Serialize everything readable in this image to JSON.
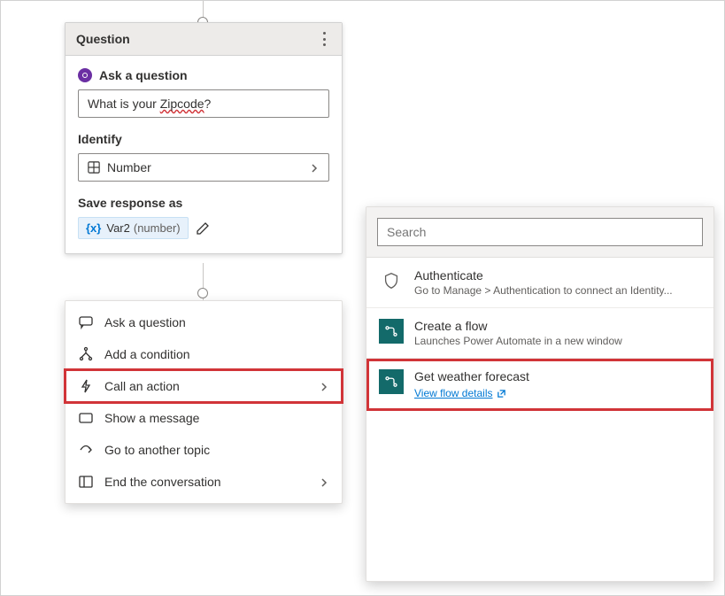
{
  "question_card": {
    "header_title": "Question",
    "ask_label": "Ask a question",
    "question_text_prefix": "What is your ",
    "question_text_word": "Zipcode",
    "question_text_suffix": "?",
    "identify_label": "Identify",
    "identify_value": "Number",
    "save_label": "Save response as",
    "variable_name": "Var2",
    "variable_type": "(number)"
  },
  "action_menu": {
    "items": [
      {
        "icon": "chat",
        "label": "Ask a question"
      },
      {
        "icon": "branch",
        "label": "Add a condition"
      },
      {
        "icon": "bolt",
        "label": "Call an action",
        "has_chevron": true,
        "highlighted": true
      },
      {
        "icon": "message",
        "label": "Show a message"
      },
      {
        "icon": "share",
        "label": "Go to another topic"
      },
      {
        "icon": "panel",
        "label": "End the conversation",
        "has_chevron": true
      }
    ]
  },
  "flyout": {
    "search_placeholder": "Search",
    "items": [
      {
        "icon": "shield",
        "title": "Authenticate",
        "desc": "Go to Manage > Authentication to connect an Identity..."
      },
      {
        "icon": "flow",
        "title": "Create a flow",
        "desc": "Launches Power Automate in a new window"
      },
      {
        "icon": "flow",
        "title": "Get weather forecast",
        "link": "View flow details",
        "highlighted": true
      }
    ]
  }
}
